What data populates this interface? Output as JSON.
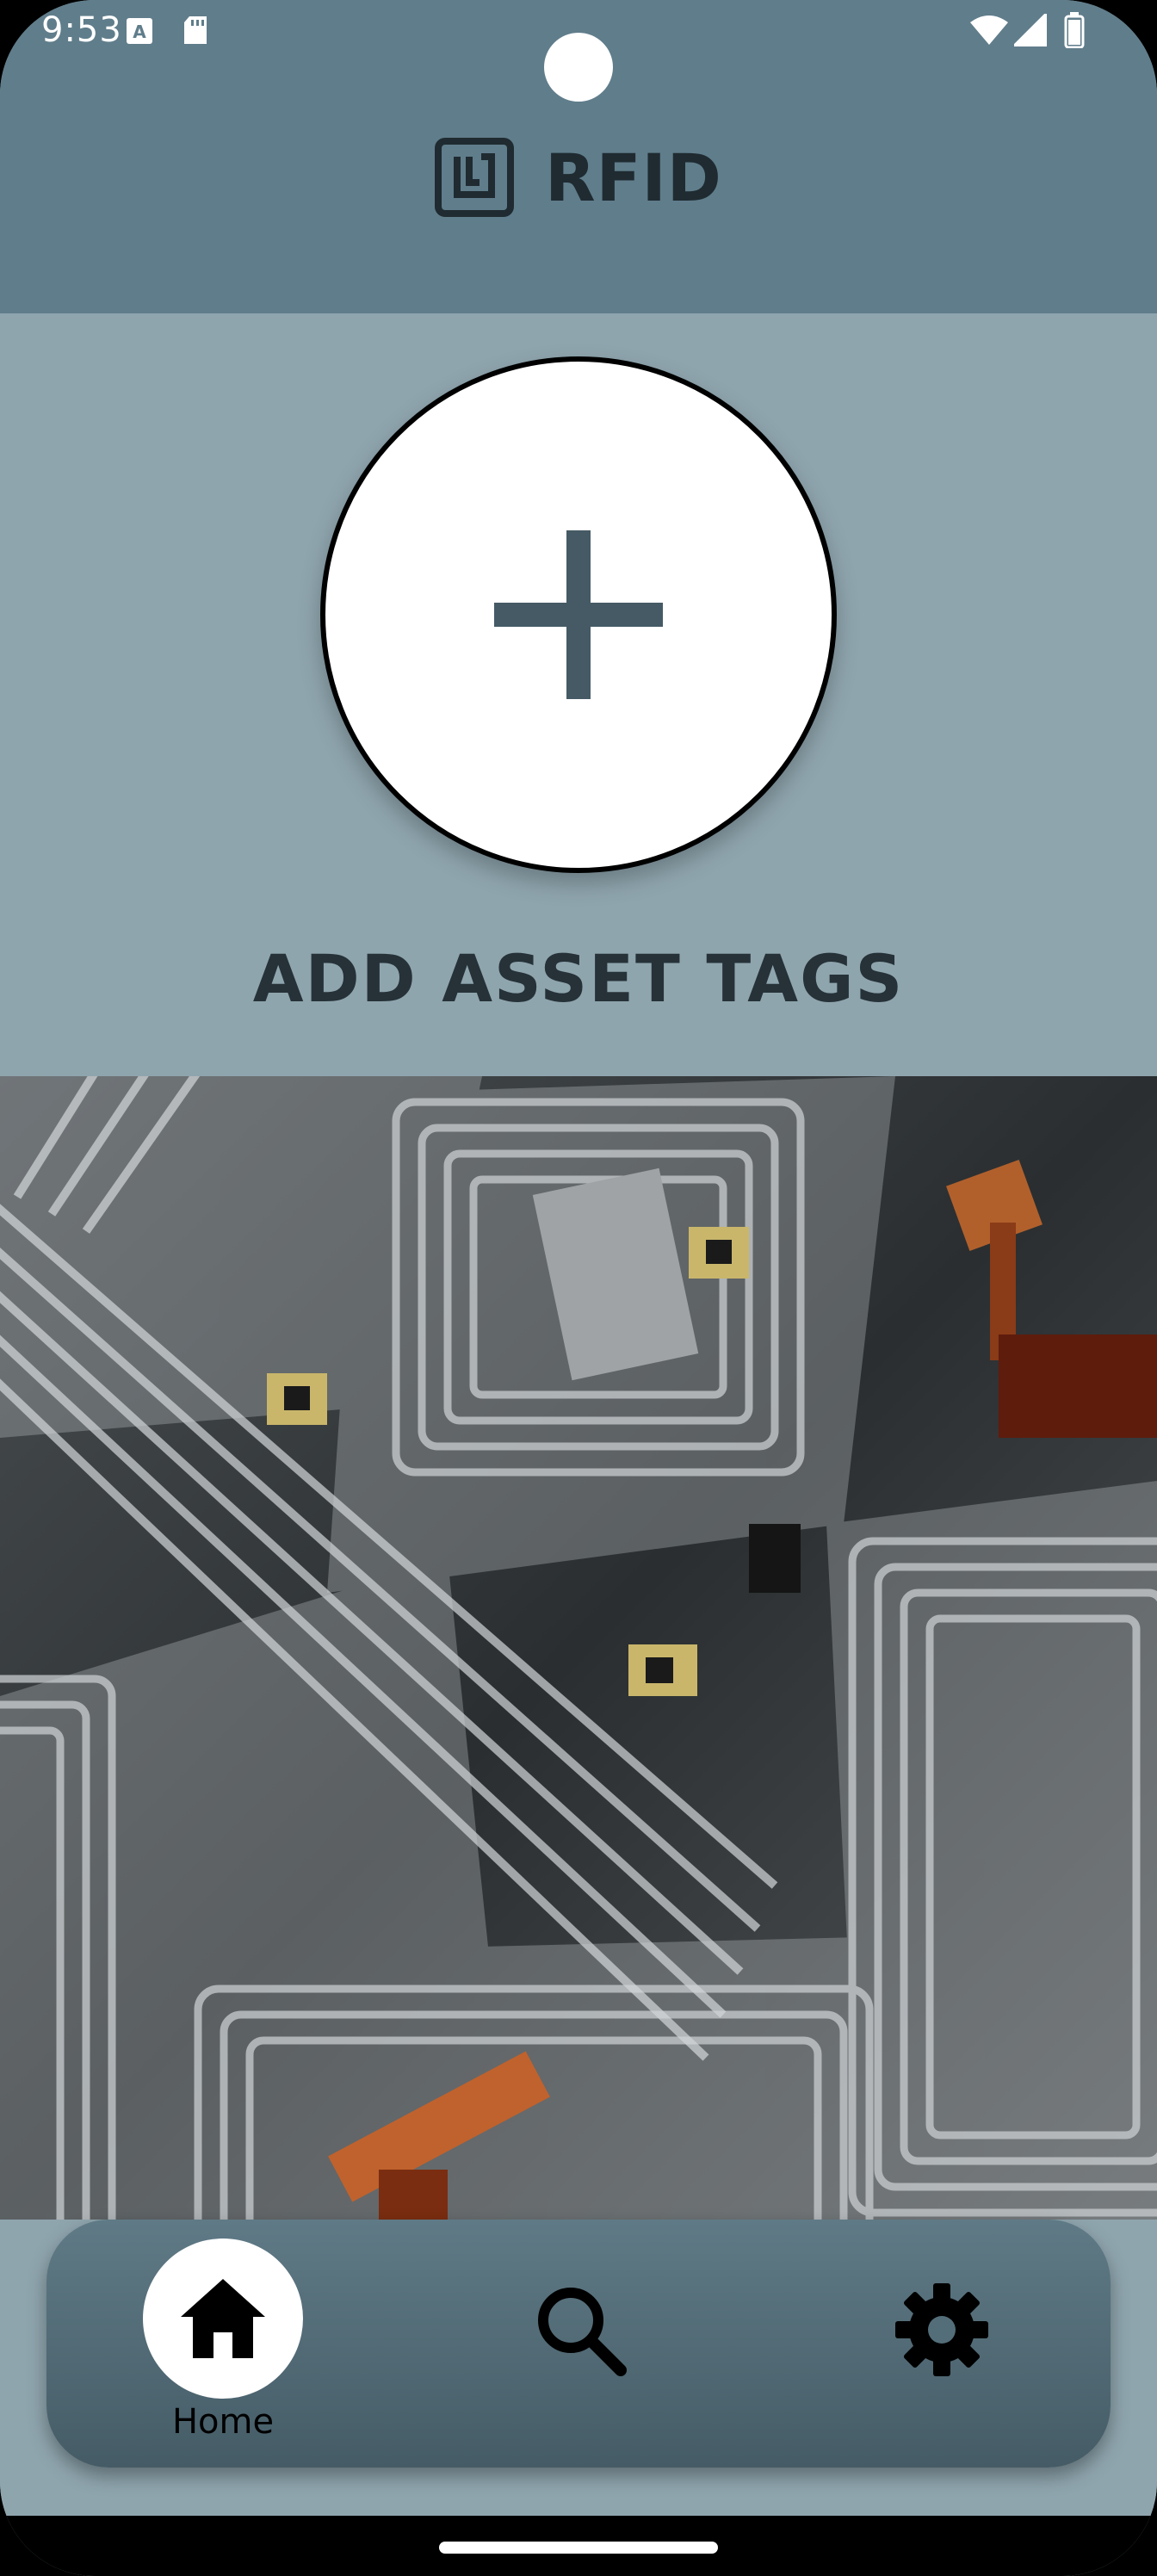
{
  "status_bar": {
    "time": "9:53",
    "icons": [
      "a11y-icon",
      "sd-card-icon",
      "wifi-icon",
      "signal-icon",
      "battery-icon"
    ]
  },
  "app_bar": {
    "title": "RFID",
    "logo_icon": "rfid-tag-icon"
  },
  "main": {
    "add_button_icon": "plus-icon",
    "add_label": "ADD ASSET TAGS"
  },
  "bottom_nav": {
    "items": [
      {
        "label": "Home",
        "icon": "home-icon",
        "selected": true
      },
      {
        "label": "",
        "icon": "search-icon",
        "selected": false
      },
      {
        "label": "",
        "icon": "gear-icon",
        "selected": false
      }
    ]
  },
  "colors": {
    "app_bar": "#607d8b",
    "background": "#8fa5ae",
    "nav_bar": "#4f6873",
    "accent_dark": "#455a64"
  }
}
